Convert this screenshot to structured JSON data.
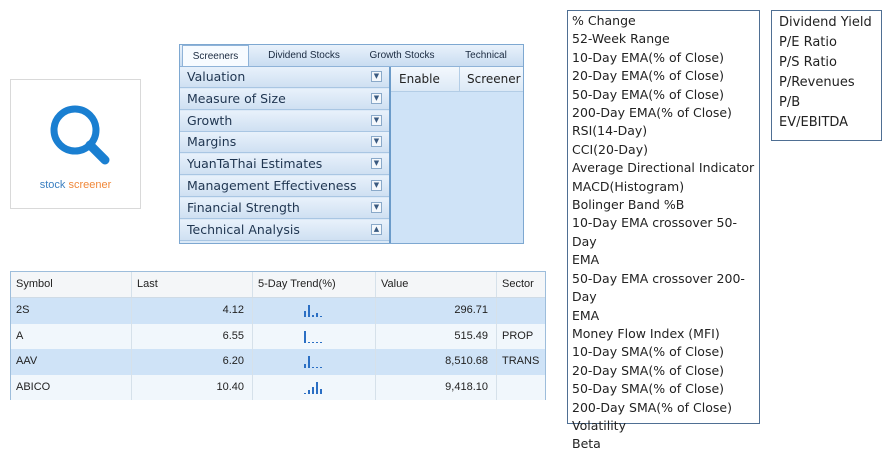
{
  "logo": {
    "word1": "stock",
    "word2": "screener",
    "colors": {
      "icon": "#1a7fd1",
      "word1": "#3a7fc1",
      "word2": "#f0883a"
    }
  },
  "screener_tabs": [
    "Screeners",
    "Dividend Stocks",
    "Growth Stocks",
    "Technical"
  ],
  "accordion": [
    {
      "label": "Valuation",
      "expanded": false
    },
    {
      "label": "Measure of Size",
      "expanded": false
    },
    {
      "label": "Growth",
      "expanded": false
    },
    {
      "label": "Margins",
      "expanded": false
    },
    {
      "label": "YuanTaThai Estimates",
      "expanded": false
    },
    {
      "label": "Management Effectiveness",
      "expanded": false
    },
    {
      "label": "Financial Strength",
      "expanded": false
    },
    {
      "label": "Technical Analysis",
      "expanded": true
    }
  ],
  "right_panel": {
    "col_enable": "Enable",
    "col_screener": "Screener"
  },
  "table": {
    "headers": [
      "Symbol",
      "Last",
      "5-Day Trend(%)",
      "Value",
      "Sector"
    ],
    "rows": [
      {
        "symbol": "2S",
        "last": "4.12",
        "value": "296.71",
        "sector": "",
        "trend": [
          5,
          10,
          2,
          3,
          1
        ]
      },
      {
        "symbol": "A",
        "last": "6.55",
        "value": "515.49",
        "sector": "PROP",
        "trend": [
          10,
          1,
          1,
          1,
          1
        ]
      },
      {
        "symbol": "AAV",
        "last": "6.20",
        "value": "8,510.68",
        "sector": "TRANS",
        "trend": [
          3,
          10,
          1,
          1,
          1
        ]
      },
      {
        "symbol": "ABICO",
        "last": "10.40",
        "value": "9,418.10",
        "sector": "",
        "trend": [
          1,
          3,
          6,
          10,
          4
        ]
      }
    ]
  },
  "indicators": [
    "% Change",
    "52-Week Range",
    "10-Day EMA(% of Close)",
    "20-Day EMA(% of Close)",
    "50-Day EMA(% of Close)",
    "200-Day EMA(% of Close)",
    "RSI(14-Day)",
    "CCI(20-Day)",
    "Average Directional Indicator",
    "MACD(Histogram)",
    "Bolinger Band %B",
    "10-Day EMA crossover 50-Day",
    "EMA",
    "50-Day EMA crossover 200-Day",
    "EMA",
    "Money Flow Index (MFI)",
    "10-Day SMA(% of Close)",
    "20-Day SMA(% of Close)",
    "50-Day SMA(% of Close)",
    "200-Day SMA(% of Close)",
    "Volatility",
    "Beta"
  ],
  "valuation_metrics": [
    "Dividend Yield",
    "P/E Ratio",
    "P/S Ratio",
    "P/Revenues",
    "P/B",
    "EV/EBITDA"
  ],
  "icons": {
    "logo": "magnifier-icon",
    "accordion_collapsed": "chevron-down-icon",
    "accordion_expanded": "chevron-up-icon"
  }
}
